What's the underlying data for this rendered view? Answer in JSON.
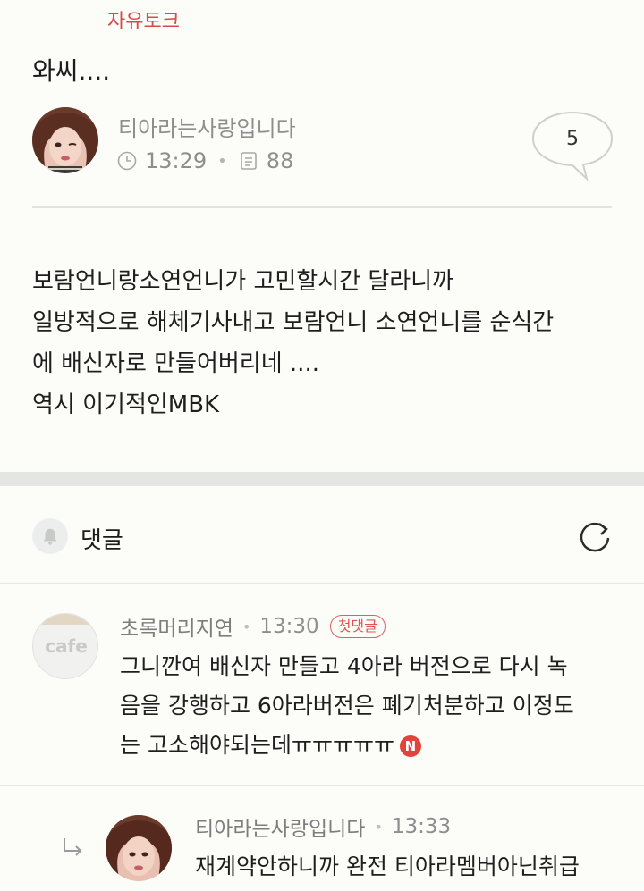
{
  "post": {
    "category": "자유토크",
    "title": "와씨....",
    "author": "티아라는사랑입니다",
    "time": "13:29",
    "views": "88",
    "comment_count": "5",
    "body_lines": [
      "보람언니랑소연언니가 고민할시간 달라니까",
      "일방적으로 해체기사내고 보람언니 소연언니를 순식간",
      "에 배신자로 만들어버리네 ....",
      "역시 이기적인MBK"
    ]
  },
  "comments_section": {
    "title": "댓글"
  },
  "comments": [
    {
      "avatar_label": "cafe",
      "author": "초록머리지연",
      "time": "13:30",
      "badge": "첫댓글",
      "lines": [
        "그니깐여 배신자 만들고 4아라 버전으로 다시 녹",
        "음을 강행하고 6아라버전은 폐기처분하고 이정도",
        "는 고소해야되는데ㅠㅠㅠㅠㅠ"
      ],
      "new_badge": "N"
    },
    {
      "author": "티아라는사랑입니다",
      "time": "13:33",
      "text": "재계약안하니까 완전 티아라멤버아닌취급"
    }
  ],
  "icons": {
    "clock": "clock-icon",
    "views": "document-icon",
    "bubble": "speech-bubble-icon",
    "bell": "bell-icon",
    "refresh": "refresh-icon",
    "reply": "reply-arrow-icon"
  },
  "colors": {
    "accent_red": "#d84a4a",
    "background": "#fcfdf8",
    "muted_text": "#8e8e8e"
  }
}
